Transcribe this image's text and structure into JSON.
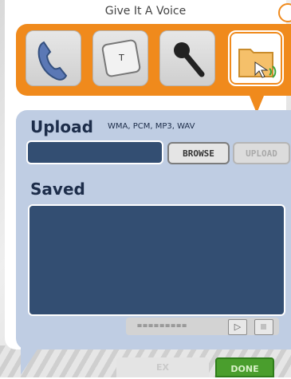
{
  "window": {
    "title": "Give It A Voice"
  },
  "tools": [
    {
      "name": "phone",
      "icon": "phone-icon",
      "selected": false
    },
    {
      "name": "keyboard-key",
      "icon": "key-t-icon",
      "key_letter": "T",
      "selected": false
    },
    {
      "name": "microphone",
      "icon": "microphone-icon",
      "selected": false
    },
    {
      "name": "upload-folder",
      "icon": "folder-sound-icon",
      "selected": true
    }
  ],
  "upload": {
    "title": "Upload",
    "formats": "WMA, PCM, MP3, WAV",
    "file_value": "",
    "browse_label": "BROWSE",
    "upload_label": "UPLOAD"
  },
  "saved": {
    "title": "Saved",
    "items": [],
    "grip": "=========",
    "play_symbol": "▷"
  },
  "footer": {
    "ex_label": "EX",
    "done_label": "DONE"
  },
  "colors": {
    "accent": "#f08a1c",
    "panel": "#bfcde3",
    "field": "#334e72",
    "done": "#4a9e2d"
  }
}
